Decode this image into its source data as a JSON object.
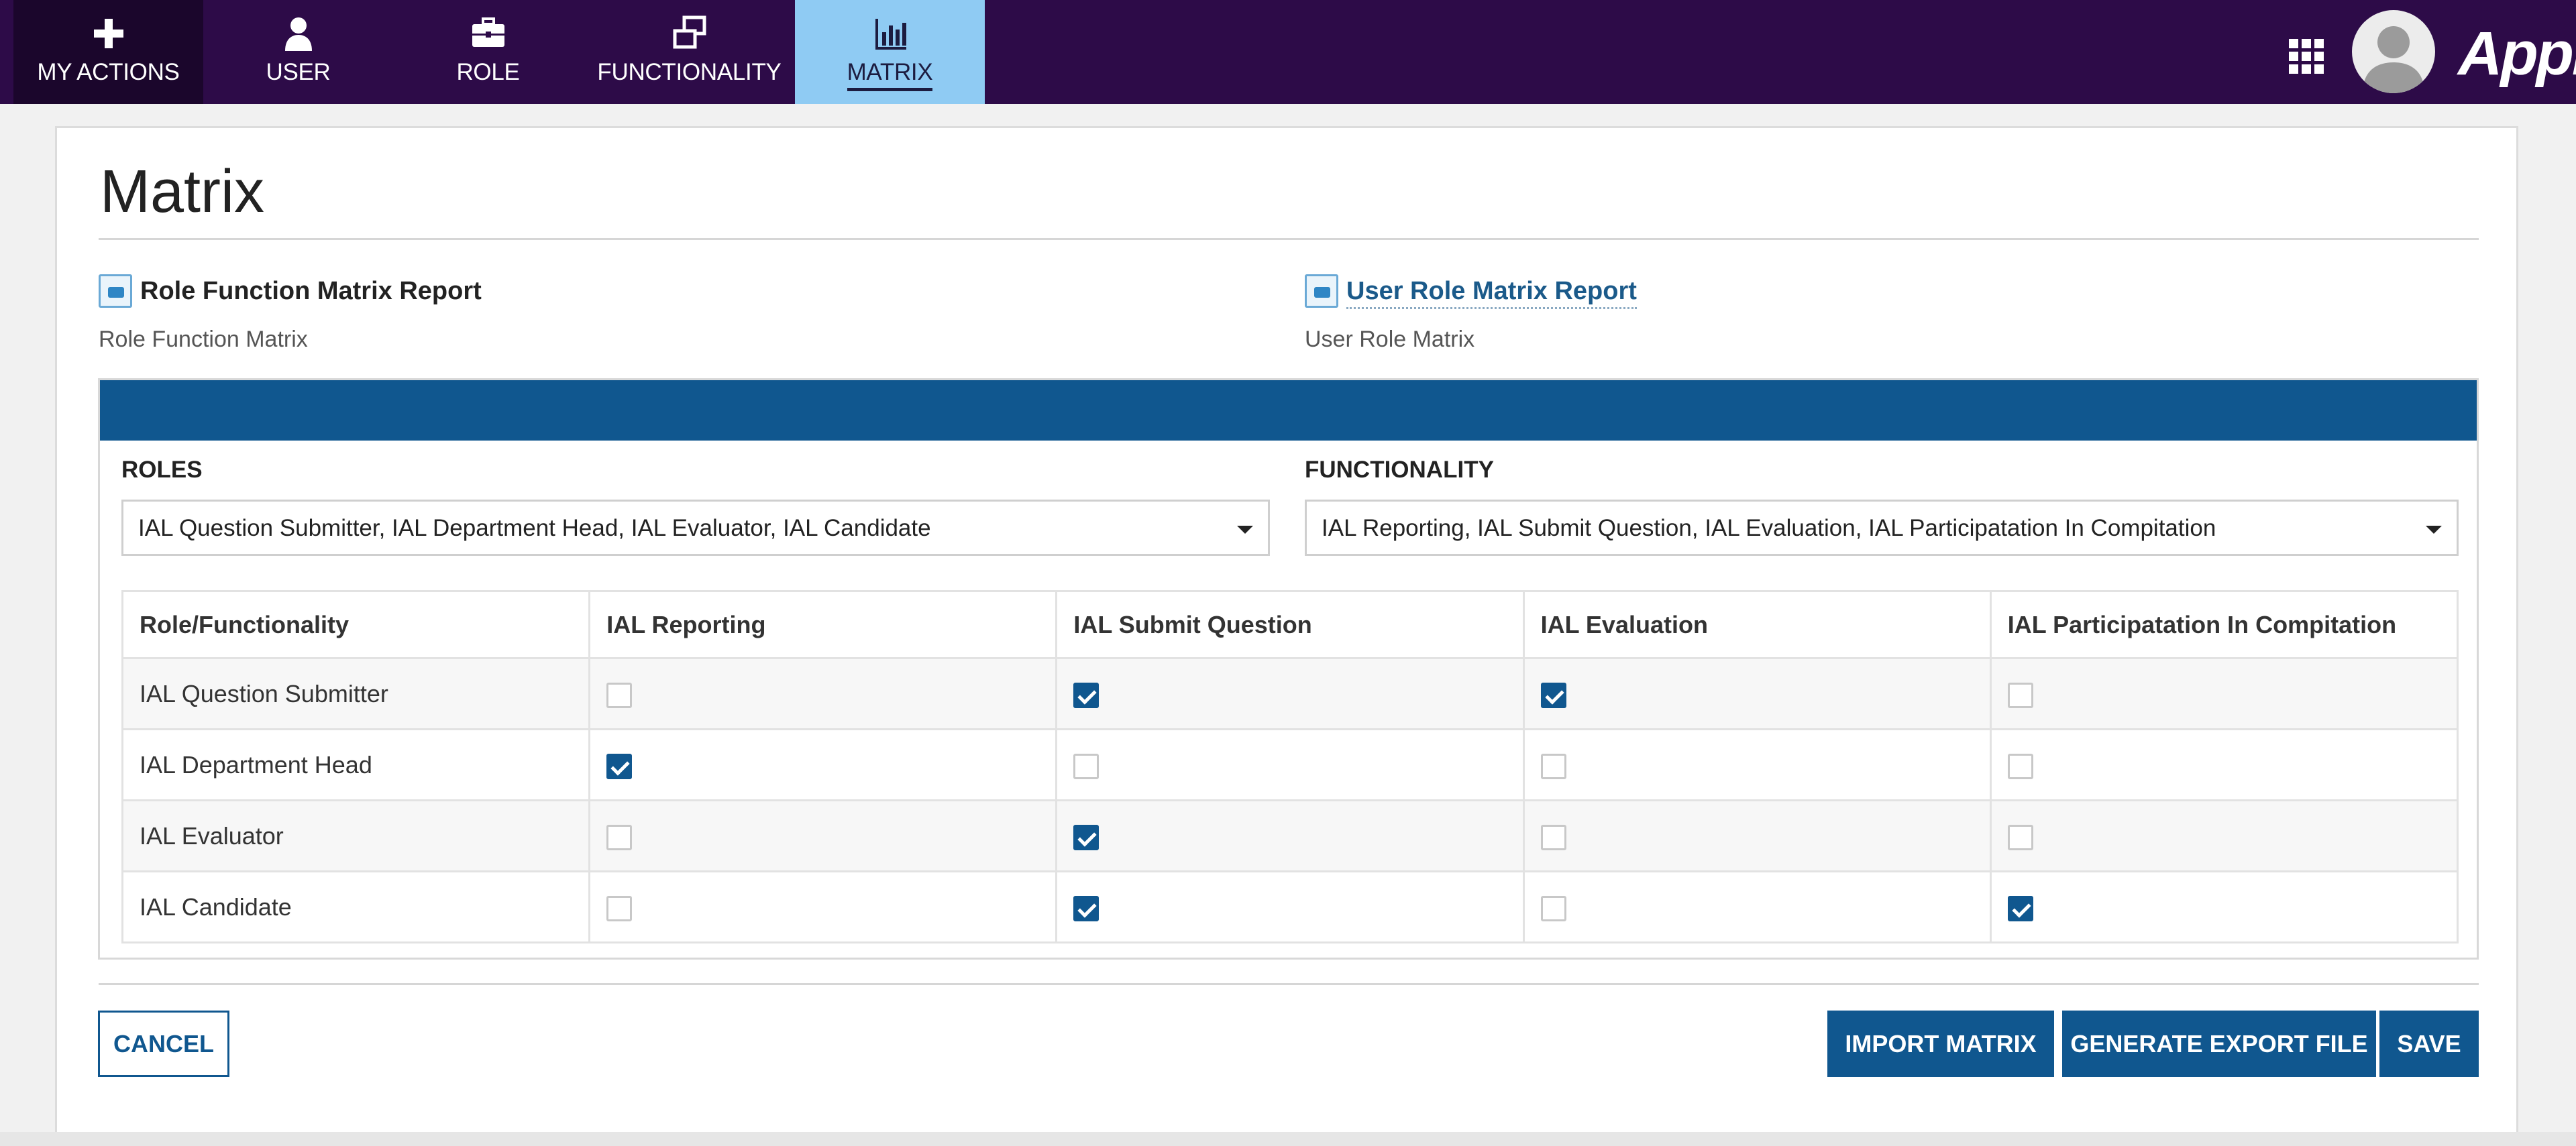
{
  "nav": {
    "tabs": [
      {
        "label": "MY ACTIONS",
        "icon": "plus-icon"
      },
      {
        "label": "USER",
        "icon": "user-icon"
      },
      {
        "label": "ROLE",
        "icon": "briefcase-icon"
      },
      {
        "label": "FUNCTIONALITY",
        "icon": "windows-icon"
      },
      {
        "label": "MATRIX",
        "icon": "bar-chart-icon"
      }
    ],
    "active_tab": "MATRIX",
    "brand": "Appian",
    "colors": {
      "bar": "#2d0b48",
      "active_tab": "#8fcbf3"
    }
  },
  "page": {
    "title": "Matrix"
  },
  "reports": [
    {
      "title": "Role Function Matrix Report",
      "subtitle": "Role Function Matrix",
      "icon": "report-icon"
    },
    {
      "title": "User Role Matrix Report",
      "subtitle": "User Role Matrix",
      "icon": "report-icon"
    }
  ],
  "filters": {
    "roles": {
      "label": "ROLES",
      "value": "IAL Question Submitter, IAL Department Head, IAL Evaluator, IAL Candidate"
    },
    "functionality": {
      "label": "FUNCTIONALITY",
      "value": "IAL Reporting, IAL Submit Question, IAL Evaluation, IAL Participatation In Compitation"
    }
  },
  "matrix": {
    "headers": [
      "Role/Functionality",
      "IAL Reporting",
      "IAL Submit Question",
      "IAL Evaluation",
      "IAL Participatation In Compitation"
    ],
    "rows": [
      {
        "role": "IAL Question Submitter",
        "checks": [
          false,
          true,
          true,
          false
        ]
      },
      {
        "role": "IAL Department Head",
        "checks": [
          true,
          false,
          false,
          false
        ]
      },
      {
        "role": "IAL Evaluator",
        "checks": [
          false,
          true,
          false,
          false
        ]
      },
      {
        "role": "IAL Candidate",
        "checks": [
          false,
          true,
          false,
          true
        ]
      }
    ],
    "accent": "#10578f"
  },
  "actions": {
    "cancel": "CANCEL",
    "import": "IMPORT MATRIX",
    "export": "GENERATE EXPORT FILE",
    "save": "SAVE"
  }
}
